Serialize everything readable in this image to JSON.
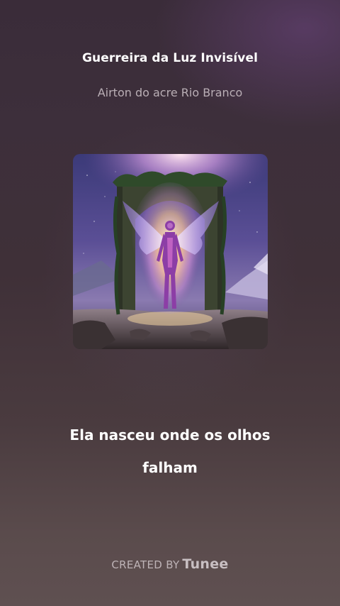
{
  "song": {
    "title": "Guerreira da Luz Invisível",
    "artist": "Airton do acre Rio Branco"
  },
  "cover_art": {
    "description_icon": "angel-portal-cover-art"
  },
  "lyrics": {
    "line1": "Ela nasceu onde os olhos",
    "line2": "falham"
  },
  "footer": {
    "created_by": "CREATED BY",
    "brand": "Tunee"
  },
  "colors": {
    "text_primary": "#ffffff",
    "text_secondary": "#b9aeb5",
    "bg_top": "#3a2c39",
    "bg_bottom": "#5f5051",
    "accent_purple": "#8a5cc0"
  }
}
